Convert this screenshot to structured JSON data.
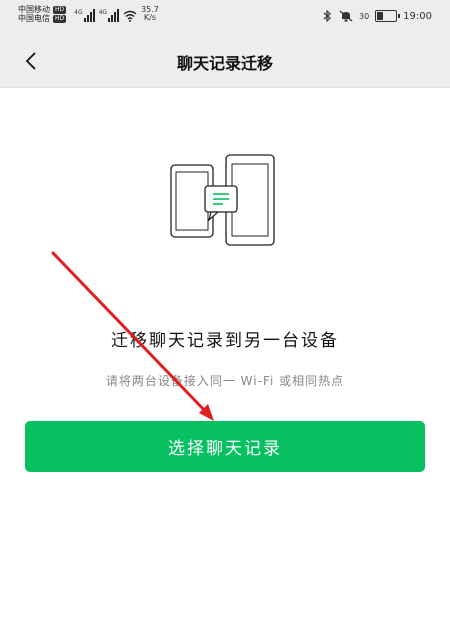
{
  "status_bar": {
    "carrier_1": "中国移动",
    "carrier_2": "中国电信",
    "hd_badge": "HD",
    "signal_label": "4G",
    "net_speed": "35.7",
    "net_speed_unit": "K/s",
    "battery_percent": "30",
    "battery_level": 0.3,
    "time": "19:00"
  },
  "header": {
    "title": "聊天记录迁移",
    "back_icon": "chevron-left-icon"
  },
  "main": {
    "title": "迁移聊天记录到另一台设备",
    "subtitle": "请将两台设备接入同一 Wi-Fi 或相同热点",
    "button_label": "选择聊天记录"
  },
  "colors": {
    "accent": "#07c160",
    "annotation_arrow": "#e02020",
    "header_bg": "#ededed"
  }
}
